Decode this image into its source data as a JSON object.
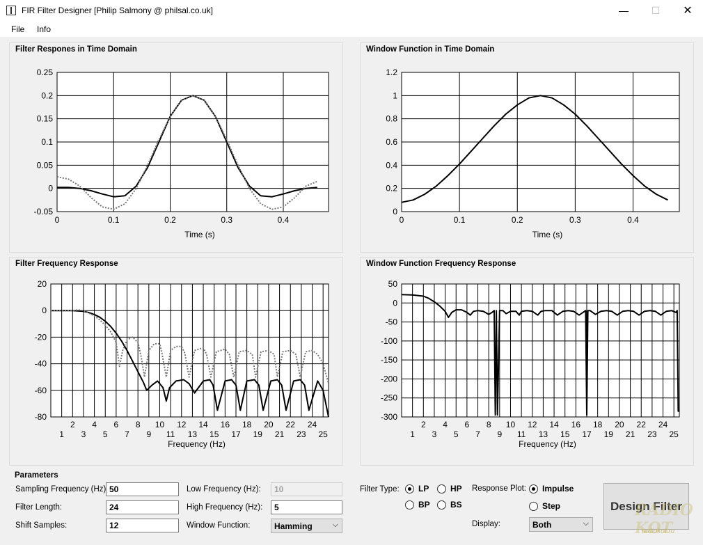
{
  "window": {
    "title": "FIR Filter Designer [Philip Salmony @ philsal.co.uk]",
    "minimize": "—",
    "maximize": "☐",
    "close": "✕"
  },
  "menu": {
    "items": [
      "File",
      "Info"
    ]
  },
  "panels": {
    "time": {
      "title": "Filter Respones in Time Domain",
      "xlabel": "Time (s)",
      "xticks": [
        "0",
        "0.1",
        "0.2",
        "0.3",
        "0.4"
      ],
      "yticks": [
        "0.25",
        "0.2",
        "0.15",
        "0.1",
        "0.05",
        "0",
        "-0.05"
      ]
    },
    "window_time": {
      "title": "Window Function in Time Domain",
      "xlabel": "Time (s)",
      "xticks": [
        "0",
        "0.1",
        "0.2",
        "0.3",
        "0.4"
      ],
      "yticks": [
        "1.2",
        "1",
        "0.8",
        "0.6",
        "0.4",
        "0.2",
        "0"
      ]
    },
    "freq": {
      "title": "Filter Frequency Response",
      "xlabel": "Frequency (Hz)",
      "xticks_even": [
        "2",
        "4",
        "6",
        "8",
        "10",
        "12",
        "14",
        "16",
        "18",
        "20",
        "22",
        "24"
      ],
      "xticks_odd": [
        "1",
        "3",
        "5",
        "7",
        "9",
        "11",
        "13",
        "15",
        "17",
        "19",
        "21",
        "23",
        "25"
      ],
      "yticks": [
        "20",
        "0",
        "-20",
        "-40",
        "-60",
        "-80"
      ]
    },
    "window_freq": {
      "title": "Window Function Frequency Response",
      "xlabel": "Frequency (Hz)",
      "xticks_even": [
        "2",
        "4",
        "6",
        "8",
        "10",
        "12",
        "14",
        "16",
        "18",
        "20",
        "22",
        "24"
      ],
      "xticks_odd": [
        "1",
        "3",
        "5",
        "7",
        "9",
        "11",
        "13",
        "15",
        "17",
        "19",
        "21",
        "23",
        "25"
      ],
      "yticks": [
        "50",
        "0",
        "-50",
        "-100",
        "-150",
        "-200",
        "-250",
        "-300"
      ]
    }
  },
  "parameters": {
    "title": "Parameters",
    "sampling_label": "Sampling Frequency (Hz):",
    "sampling_value": "50",
    "length_label": "Filter Length:",
    "length_value": "24",
    "shift_label": "Shift Samples:",
    "shift_value": "12",
    "low_label": "Low Frequency (Hz):",
    "low_value": "10",
    "high_label": "High Frequency (Hz):",
    "high_value": "5",
    "window_label": "Window Function:",
    "window_value": "Hamming",
    "filter_type_label": "Filter Type:",
    "filter_types": [
      "LP",
      "HP",
      "BP",
      "BS"
    ],
    "filter_type_selected": "LP",
    "response_plot_label": "Response Plot:",
    "response_options": [
      "Impulse",
      "Step"
    ],
    "response_selected": "Impulse",
    "display_label": "Display:",
    "display_value": "Both",
    "design_button": "Design Filter"
  },
  "watermark": {
    "main": "RADIO KOT",
    "sub": "radiokot.ru"
  },
  "chart_data": [
    {
      "type": "line",
      "title": "Filter Respones in Time Domain",
      "xlabel": "Time (s)",
      "xlim": [
        0,
        0.48
      ],
      "ylim": [
        -0.05,
        0.25
      ],
      "series": [
        {
          "style": "solid-black",
          "x": [
            0,
            0.02,
            0.04,
            0.06,
            0.08,
            0.1,
            0.12,
            0.14,
            0.16,
            0.18,
            0.2,
            0.22,
            0.24,
            0.26,
            0.28,
            0.3,
            0.32,
            0.34,
            0.36,
            0.38,
            0.4,
            0.42,
            0.44,
            0.46
          ],
          "y": [
            0.002,
            0.002,
            0.0,
            -0.005,
            -0.012,
            -0.018,
            -0.016,
            0.005,
            0.045,
            0.1,
            0.155,
            0.19,
            0.2,
            0.19,
            0.155,
            0.1,
            0.045,
            0.005,
            -0.016,
            -0.018,
            -0.012,
            -0.005,
            0.0,
            0.002
          ]
        },
        {
          "style": "dotted-gray",
          "x": [
            0,
            0.02,
            0.04,
            0.06,
            0.08,
            0.1,
            0.12,
            0.14,
            0.16,
            0.18,
            0.2,
            0.22,
            0.24,
            0.26,
            0.28,
            0.3,
            0.32,
            0.34,
            0.36,
            0.38,
            0.4,
            0.42,
            0.44,
            0.46
          ],
          "y": [
            0.025,
            0.02,
            0.005,
            -0.02,
            -0.04,
            -0.045,
            -0.033,
            0.0,
            0.05,
            0.105,
            0.155,
            0.19,
            0.2,
            0.19,
            0.155,
            0.105,
            0.05,
            0.0,
            -0.033,
            -0.045,
            -0.04,
            -0.02,
            0.005,
            0.015
          ]
        }
      ]
    },
    {
      "type": "line",
      "title": "Window Function in Time Domain",
      "xlabel": "Time (s)",
      "xlim": [
        0,
        0.48
      ],
      "ylim": [
        0,
        1.2
      ],
      "series": [
        {
          "style": "solid-black",
          "x": [
            0,
            0.02,
            0.04,
            0.06,
            0.08,
            0.1,
            0.12,
            0.14,
            0.16,
            0.18,
            0.2,
            0.22,
            0.24,
            0.26,
            0.28,
            0.3,
            0.32,
            0.34,
            0.36,
            0.38,
            0.4,
            0.42,
            0.44,
            0.46
          ],
          "y": [
            0.08,
            0.1,
            0.15,
            0.22,
            0.31,
            0.41,
            0.52,
            0.63,
            0.74,
            0.84,
            0.92,
            0.98,
            1.0,
            0.98,
            0.92,
            0.84,
            0.74,
            0.63,
            0.52,
            0.41,
            0.31,
            0.22,
            0.15,
            0.1
          ]
        }
      ]
    },
    {
      "type": "line",
      "title": "Filter Frequency Response",
      "xlabel": "Frequency (Hz)",
      "xlim": [
        0,
        25.5
      ],
      "ylim": [
        -80,
        20
      ],
      "series": [
        {
          "style": "solid-black",
          "x": [
            0,
            1,
            2,
            3,
            3.5,
            4,
            4.5,
            5,
            5.5,
            6,
            6.5,
            7,
            7.5,
            8,
            8.5,
            8.8,
            9.3,
            9.8,
            10.3,
            10.6,
            10.9,
            11.5,
            12.2,
            12.7,
            13.2,
            14,
            14.6,
            14.9,
            15.3,
            16,
            16.6,
            17,
            17.4,
            18,
            18.7,
            19.1,
            19.5,
            20.2,
            20.8,
            21.2,
            21.6,
            22.3,
            22.9,
            23.3,
            23.7,
            24.5,
            25,
            25.5
          ],
          "y": [
            0,
            0,
            0,
            -0.5,
            -1.5,
            -3,
            -5,
            -8,
            -12,
            -17,
            -23,
            -30,
            -38,
            -46,
            -54,
            -60,
            -56,
            -53,
            -58,
            -68,
            -58,
            -53,
            -52,
            -55,
            -62,
            -53,
            -52,
            -56,
            -75,
            -53,
            -52,
            -56,
            -75,
            -53,
            -52,
            -56,
            -75,
            -53,
            -52,
            -56,
            -75,
            -53,
            -52,
            -56,
            -75,
            -53,
            -60,
            -80
          ]
        },
        {
          "style": "dotted-gray",
          "x": [
            0,
            1,
            2,
            2.5,
            3,
            3.5,
            4,
            4.5,
            5,
            5.5,
            6,
            6.3,
            6.6,
            7,
            7.5,
            8,
            8.3,
            8.6,
            9,
            9.5,
            10,
            10.2,
            10.6,
            11,
            11.5,
            12,
            12.3,
            12.7,
            13.2,
            14,
            14.3,
            14.7,
            15.2,
            16,
            16.4,
            16.8,
            17.3,
            18,
            18.5,
            18.8,
            19.3,
            20,
            20.5,
            20.8,
            21.3,
            22,
            22.5,
            22.9,
            23.4,
            24,
            24.5,
            25,
            25.5
          ],
          "y": [
            0,
            0,
            0,
            0.5,
            0,
            -2,
            -4,
            -7,
            -11,
            -16,
            -24,
            -42,
            -30,
            -22,
            -20,
            -24,
            -35,
            -50,
            -30,
            -25,
            -25,
            -32,
            -50,
            -30,
            -27,
            -27,
            -32,
            -50,
            -30,
            -28,
            -33,
            -50,
            -31,
            -29,
            -33,
            -50,
            -31,
            -30,
            -33,
            -50,
            -31,
            -30,
            -33,
            -50,
            -31,
            -30,
            -33,
            -50,
            -31,
            -30,
            -33,
            -40,
            -55
          ]
        }
      ]
    },
    {
      "type": "line",
      "title": "Window Function Frequency Response",
      "xlabel": "Frequency (Hz)",
      "xlim": [
        0,
        25.5
      ],
      "ylim": [
        -300,
        50
      ],
      "series": [
        {
          "style": "solid-black",
          "x": [
            0,
            1,
            2,
            2.5,
            3,
            3.5,
            4,
            4.3,
            4.6,
            5,
            5.5,
            6,
            6.3,
            6.6,
            7,
            7.5,
            8,
            8.3,
            8.5,
            8.6,
            8.7,
            8.8,
            9,
            9.3,
            9.6,
            10,
            10.5,
            10.8,
            11,
            11.5,
            12,
            12.5,
            12.8,
            13.2,
            13.8,
            14.3,
            14.8,
            15.3,
            15.8,
            16.3,
            16.8,
            16.9,
            17.0,
            17.1,
            17.3,
            17.8,
            18.3,
            18.8,
            19.3,
            19.8,
            20.3,
            20.8,
            21.3,
            21.8,
            22.3,
            22.8,
            23.3,
            23.8,
            24.3,
            24.8,
            25.2,
            25.3,
            25.4,
            25.5
          ],
          "y": [
            22,
            21,
            18,
            12,
            3,
            -8,
            -22,
            -38,
            -25,
            -18,
            -18,
            -25,
            -32,
            -22,
            -20,
            -22,
            -30,
            -25,
            -20,
            -295,
            -20,
            -295,
            -20,
            -20,
            -28,
            -22,
            -22,
            -32,
            -22,
            -20,
            -22,
            -32,
            -22,
            -20,
            -20,
            -32,
            -22,
            -20,
            -22,
            -32,
            -22,
            -20,
            -295,
            -20,
            -20,
            -30,
            -22,
            -20,
            -22,
            -32,
            -22,
            -20,
            -22,
            -32,
            -22,
            -20,
            -22,
            -32,
            -22,
            -20,
            -25,
            -20,
            -285,
            -285
          ]
        }
      ]
    }
  ]
}
